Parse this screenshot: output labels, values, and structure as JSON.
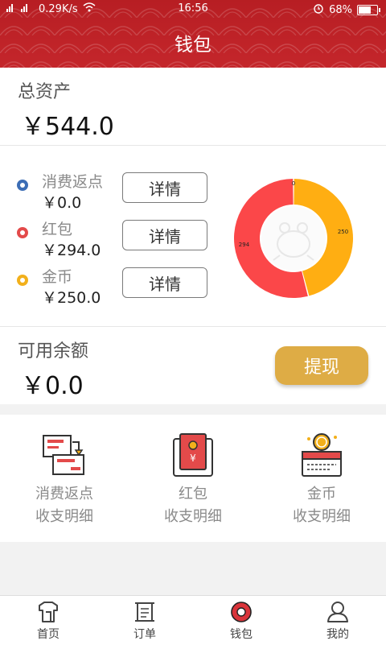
{
  "status_bar": {
    "signal_text": "4G 4G",
    "network_speed": "0.29K/s",
    "time": "16:56",
    "battery_percent": "68%",
    "battery_level": 0.68
  },
  "header": {
    "title": "钱包"
  },
  "total_assets": {
    "label": "总资产",
    "value": "￥544.0"
  },
  "assets": [
    {
      "name": "消费返点",
      "value": "￥0.0",
      "button": "详情",
      "color": "#3c6db5"
    },
    {
      "name": "红包",
      "value": "￥294.0",
      "button": "详情",
      "color": "#e34a4a"
    },
    {
      "name": "金币",
      "value": "￥250.0",
      "button": "详情",
      "color": "#f2b01b"
    }
  ],
  "chart_data": {
    "type": "pie",
    "donut": true,
    "slices": [
      {
        "label": "0",
        "value": 0,
        "color": "#3c6db5"
      },
      {
        "label": "250",
        "value": 250,
        "color": "#ffae12"
      },
      {
        "label": "294",
        "value": 294,
        "color": "#fb4749"
      }
    ]
  },
  "available_balance": {
    "label": "可用余额",
    "value": "￥0.0",
    "withdraw_button": "提现"
  },
  "ledgers": [
    {
      "line1": "消费返点",
      "line2": "收支明细",
      "icon": "rebate-ledger-icon"
    },
    {
      "line1": "红包",
      "line2": "收支明细",
      "icon": "red-envelope-icon"
    },
    {
      "line1": "金币",
      "line2": "收支明细",
      "icon": "gold-coin-box-icon"
    }
  ],
  "tabs": [
    {
      "label": "首页",
      "icon": "home-shirt-icon"
    },
    {
      "label": "订单",
      "icon": "scroll-icon"
    },
    {
      "label": "钱包",
      "icon": "wallet-coin-icon",
      "active": true
    },
    {
      "label": "我的",
      "icon": "user-icon"
    }
  ]
}
